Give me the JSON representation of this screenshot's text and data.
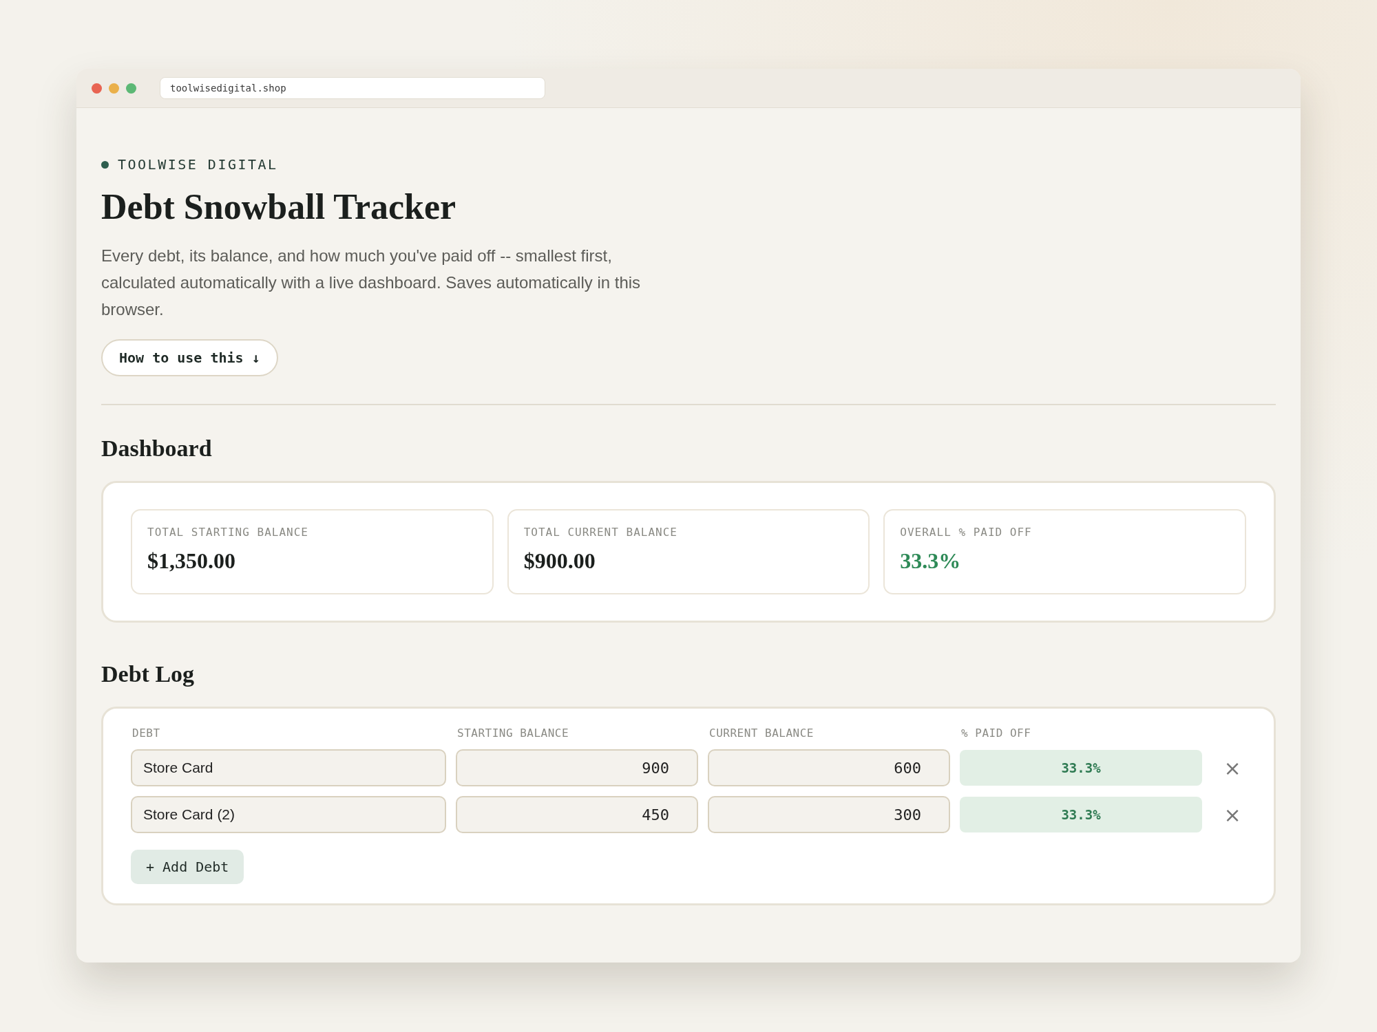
{
  "browser": {
    "url": "toolwisedigital.shop"
  },
  "brand": "TOOLWISE DIGITAL",
  "title": "Debt Snowball Tracker",
  "description": "Every debt, its balance, and how much you've paid off -- smallest first, calculated automatically with a live dashboard. Saves automatically in this browser.",
  "help_button": "How to use this ↓",
  "dashboard": {
    "heading": "Dashboard",
    "stats": [
      {
        "label": "TOTAL STARTING BALANCE",
        "value": "$1,350.00",
        "kind": "plain"
      },
      {
        "label": "TOTAL CURRENT BALANCE",
        "value": "$900.00",
        "kind": "plain"
      },
      {
        "label": "OVERALL % PAID OFF",
        "value": "33.3%",
        "kind": "positive"
      }
    ]
  },
  "debt_log": {
    "heading": "Debt Log",
    "columns": [
      "DEBT",
      "STARTING BALANCE",
      "CURRENT BALANCE",
      "% PAID OFF"
    ],
    "rows": [
      {
        "debt": "Store Card",
        "starting": "900",
        "current": "600",
        "paid": "33.3%",
        "remove": "×"
      },
      {
        "debt": "Store Card (2)",
        "starting": "450",
        "current": "300",
        "paid": "33.3%",
        "remove": "×"
      }
    ],
    "add_button": "+ Add Debt"
  }
}
